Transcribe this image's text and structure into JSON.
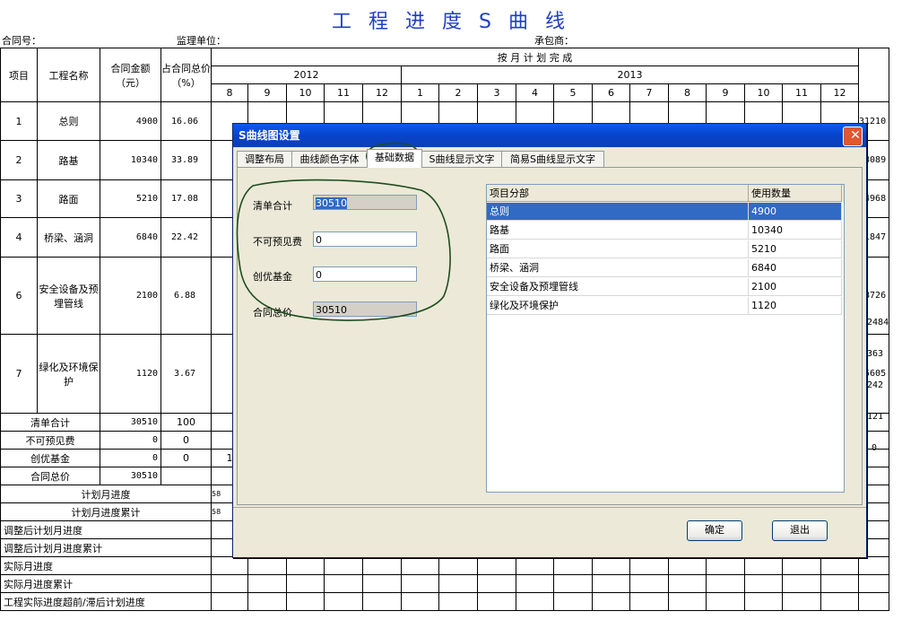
{
  "sheet": {
    "title": "工 程 进 度 S 曲 线",
    "contract_no_label": "合同号：",
    "supervisor_label": "监理单位：",
    "contractor_label": "承包商：",
    "headers": {
      "item": "项目",
      "name": "工程名称",
      "amount": "合同金额（元）",
      "ratio": "占合同总价（%）",
      "plan": "按 月 计 划 完 成",
      "year1": "2012",
      "year2": "2013",
      "months": [
        "8",
        "9",
        "10",
        "11",
        "12",
        "1",
        "2",
        "3",
        "4",
        "5",
        "6",
        "7",
        "8",
        "9",
        "10",
        "11",
        "12"
      ]
    },
    "rows": [
      {
        "no": "1",
        "name": "总则",
        "amount": "4900",
        "ratio": "16.06",
        "right": "31210"
      },
      {
        "no": "2",
        "name": "路基",
        "amount": "10340",
        "ratio": "33.89",
        "right": "28089"
      },
      {
        "no": "3",
        "name": "路面",
        "amount": "5210",
        "ratio": "17.08",
        "right": "24968"
      },
      {
        "no": "4",
        "name": "桥梁、涵洞",
        "amount": "6840",
        "ratio": "22.42",
        "right": "21847"
      },
      {
        "no": "6",
        "name": "安全设备及预埋管线",
        "amount": "2100",
        "ratio": "6.88",
        "right": "18726"
      },
      {
        "no": "7",
        "name": "绿化及环境保护",
        "amount": "1120",
        "ratio": "3.67",
        "right": "15605"
      }
    ],
    "extra_right": [
      "12484",
      "9363",
      "6242",
      "3121",
      "0"
    ],
    "summary": [
      {
        "label": "清单合计",
        "amount": "30510",
        "ratio": "100"
      },
      {
        "label": "不可预见费",
        "amount": "0",
        "ratio": "0"
      },
      {
        "label": "创优基金",
        "amount": "0",
        "ratio": "0"
      },
      {
        "label": "合同总价",
        "amount": "30510",
        "ratio": ""
      }
    ],
    "bottom_rows": [
      "计划月进度",
      "计划月进度累计",
      "调整后计划月进度",
      "调整后计划月进度累计",
      "实际月进度",
      "实际月进度累计",
      "工程实际进度超前/滞后计划进度"
    ],
    "plan_cells": [
      "58",
      "58"
    ],
    "cut_value": "1"
  },
  "dialog": {
    "title": "S曲线图设置",
    "tabs": [
      "调整布局",
      "曲线颜色字体",
      "基础数据",
      "S曲线显示文字",
      "简易S曲线显示文字"
    ],
    "active_tab": 2,
    "fields": [
      {
        "label": "清单合计",
        "value": "30510",
        "readonly": true,
        "selected": true
      },
      {
        "label": "不可预见费",
        "value": "0",
        "readonly": false
      },
      {
        "label": "创优基金",
        "value": "0",
        "readonly": false
      },
      {
        "label": "合同总价",
        "value": "30510",
        "readonly": true
      }
    ],
    "list_headers": [
      "项目分部",
      "使用数量"
    ],
    "list_rows": [
      {
        "part": "总则",
        "qty": "4900",
        "selected": true
      },
      {
        "part": "路基",
        "qty": "10340"
      },
      {
        "part": "路面",
        "qty": "5210"
      },
      {
        "part": "桥梁、涵洞",
        "qty": "6840"
      },
      {
        "part": "安全设备及预埋管线",
        "qty": "2100"
      },
      {
        "part": "绿化及环境保护",
        "qty": "1120"
      }
    ],
    "ok_label": "确定",
    "exit_label": "退出",
    "close_glyph": "✕"
  }
}
